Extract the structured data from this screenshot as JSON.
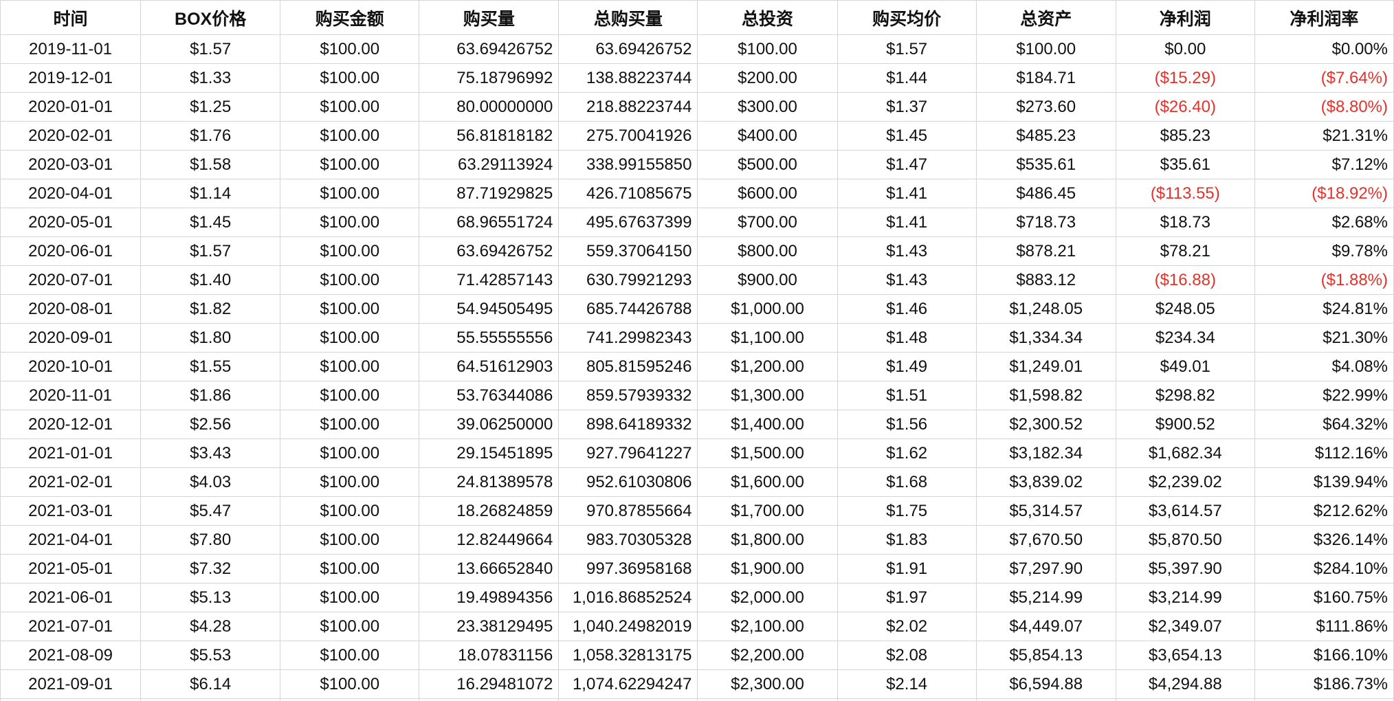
{
  "headers": [
    "时间",
    "BOX价格",
    "购买金额",
    "购买量",
    "总购买量",
    "总投资",
    "购买均价",
    "总资产",
    "净利润",
    "净利润率"
  ],
  "rows": [
    [
      "2019-11-01",
      "$1.57",
      "$100.00",
      "63.69426752",
      "63.69426752",
      "$100.00",
      "$1.57",
      "$100.00",
      "$0.00",
      "$0.00%"
    ],
    [
      "2019-12-01",
      "$1.33",
      "$100.00",
      "75.18796992",
      "138.88223744",
      "$200.00",
      "$1.44",
      "$184.71",
      "($15.29)",
      "($7.64%)"
    ],
    [
      "2020-01-01",
      "$1.25",
      "$100.00",
      "80.00000000",
      "218.88223744",
      "$300.00",
      "$1.37",
      "$273.60",
      "($26.40)",
      "($8.80%)"
    ],
    [
      "2020-02-01",
      "$1.76",
      "$100.00",
      "56.81818182",
      "275.70041926",
      "$400.00",
      "$1.45",
      "$485.23",
      "$85.23",
      "$21.31%"
    ],
    [
      "2020-03-01",
      "$1.58",
      "$100.00",
      "63.29113924",
      "338.99155850",
      "$500.00",
      "$1.47",
      "$535.61",
      "$35.61",
      "$7.12%"
    ],
    [
      "2020-04-01",
      "$1.14",
      "$100.00",
      "87.71929825",
      "426.71085675",
      "$600.00",
      "$1.41",
      "$486.45",
      "($113.55)",
      "($18.92%)"
    ],
    [
      "2020-05-01",
      "$1.45",
      "$100.00",
      "68.96551724",
      "495.67637399",
      "$700.00",
      "$1.41",
      "$718.73",
      "$18.73",
      "$2.68%"
    ],
    [
      "2020-06-01",
      "$1.57",
      "$100.00",
      "63.69426752",
      "559.37064150",
      "$800.00",
      "$1.43",
      "$878.21",
      "$78.21",
      "$9.78%"
    ],
    [
      "2020-07-01",
      "$1.40",
      "$100.00",
      "71.42857143",
      "630.79921293",
      "$900.00",
      "$1.43",
      "$883.12",
      "($16.88)",
      "($1.88%)"
    ],
    [
      "2020-08-01",
      "$1.82",
      "$100.00",
      "54.94505495",
      "685.74426788",
      "$1,000.00",
      "$1.46",
      "$1,248.05",
      "$248.05",
      "$24.81%"
    ],
    [
      "2020-09-01",
      "$1.80",
      "$100.00",
      "55.55555556",
      "741.29982343",
      "$1,100.00",
      "$1.48",
      "$1,334.34",
      "$234.34",
      "$21.30%"
    ],
    [
      "2020-10-01",
      "$1.55",
      "$100.00",
      "64.51612903",
      "805.81595246",
      "$1,200.00",
      "$1.49",
      "$1,249.01",
      "$49.01",
      "$4.08%"
    ],
    [
      "2020-11-01",
      "$1.86",
      "$100.00",
      "53.76344086",
      "859.57939332",
      "$1,300.00",
      "$1.51",
      "$1,598.82",
      "$298.82",
      "$22.99%"
    ],
    [
      "2020-12-01",
      "$2.56",
      "$100.00",
      "39.06250000",
      "898.64189332",
      "$1,400.00",
      "$1.56",
      "$2,300.52",
      "$900.52",
      "$64.32%"
    ],
    [
      "2021-01-01",
      "$3.43",
      "$100.00",
      "29.15451895",
      "927.79641227",
      "$1,500.00",
      "$1.62",
      "$3,182.34",
      "$1,682.34",
      "$112.16%"
    ],
    [
      "2021-02-01",
      "$4.03",
      "$100.00",
      "24.81389578",
      "952.61030806",
      "$1,600.00",
      "$1.68",
      "$3,839.02",
      "$2,239.02",
      "$139.94%"
    ],
    [
      "2021-03-01",
      "$5.47",
      "$100.00",
      "18.26824859",
      "970.87855664",
      "$1,700.00",
      "$1.75",
      "$5,314.57",
      "$3,614.57",
      "$212.62%"
    ],
    [
      "2021-04-01",
      "$7.80",
      "$100.00",
      "12.82449664",
      "983.70305328",
      "$1,800.00",
      "$1.83",
      "$7,670.50",
      "$5,870.50",
      "$326.14%"
    ],
    [
      "2021-05-01",
      "$7.32",
      "$100.00",
      "13.66652840",
      "997.36958168",
      "$1,900.00",
      "$1.91",
      "$7,297.90",
      "$5,397.90",
      "$284.10%"
    ],
    [
      "2021-06-01",
      "$5.13",
      "$100.00",
      "19.49894356",
      "1,016.86852524",
      "$2,000.00",
      "$1.97",
      "$5,214.99",
      "$3,214.99",
      "$160.75%"
    ],
    [
      "2021-07-01",
      "$4.28",
      "$100.00",
      "23.38129495",
      "1,040.24982019",
      "$2,100.00",
      "$2.02",
      "$4,449.07",
      "$2,349.07",
      "$111.86%"
    ],
    [
      "2021-08-09",
      "$5.53",
      "$100.00",
      "18.07831156",
      "1,058.32813175",
      "$2,200.00",
      "$2.08",
      "$5,854.13",
      "$3,654.13",
      "$166.10%"
    ],
    [
      "2021-09-01",
      "$6.14",
      "$100.00",
      "16.29481072",
      "1,074.62294247",
      "$2,300.00",
      "$2.14",
      "$6,594.88",
      "$4,294.88",
      "$186.73%"
    ]
  ],
  "colors": {
    "negative": "#e8302a",
    "grid_line": "#d4d4d4",
    "text": "#111111"
  }
}
